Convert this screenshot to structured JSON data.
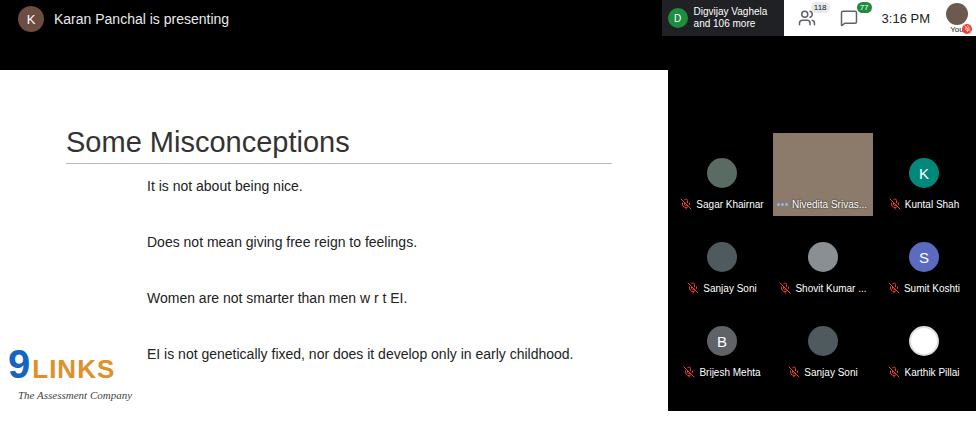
{
  "topbar": {
    "presenter": {
      "initial": "K",
      "text": "Karan Panchal is presenting",
      "color": "#6d4c41"
    },
    "participants_preview": {
      "initial": "D",
      "name": "Digvijay Vaghela",
      "more": "and 106 more",
      "color": "#1e8e3e"
    },
    "people_count": "118",
    "chat_count": "77",
    "time": "3:16 PM",
    "self": {
      "label": "You",
      "muted": true
    }
  },
  "slide": {
    "title": "Some Misconceptions",
    "bullets": [
      "It is not about being nice.",
      "Does not mean giving free reign to feelings.",
      "Women are not smarter than men w r t EI.",
      "EI is not genetically fixed, nor does it develop only in early childhood."
    ],
    "logo": {
      "number": "9",
      "word": "LINKS",
      "tagline": "The Assessment Company"
    }
  },
  "tiles": [
    {
      "name": "Sagar Khairnar",
      "kind": "photo",
      "initial": "",
      "color": "#5a6b63",
      "muted": true,
      "speaking": false
    },
    {
      "name": "Nivedita Srivas...",
      "kind": "video",
      "initial": "",
      "color": "#8c7b6b",
      "muted": false,
      "speaking": true
    },
    {
      "name": "Kuntal Shah",
      "kind": "initial",
      "initial": "K",
      "color": "#00897b",
      "muted": true,
      "speaking": false
    },
    {
      "name": "Sanjay Soni",
      "kind": "photo",
      "initial": "",
      "color": "#4e5a5e",
      "muted": true,
      "speaking": false
    },
    {
      "name": "Shovit Kumar ...",
      "kind": "photo",
      "initial": "",
      "color": "#8a8f94",
      "muted": true,
      "speaking": false
    },
    {
      "name": "Sumit Koshti",
      "kind": "initial",
      "initial": "S",
      "color": "#5c6bc0",
      "muted": true,
      "speaking": false
    },
    {
      "name": "Brijesh Mehta",
      "kind": "initial",
      "initial": "B",
      "color": "#5f6368",
      "muted": true,
      "speaking": false
    },
    {
      "name": "Sanjay Soni",
      "kind": "photo",
      "initial": "",
      "color": "#4e5a5e",
      "muted": true,
      "speaking": false
    },
    {
      "name": "Karthik Pillai",
      "kind": "logo",
      "initial": "",
      "color": "#ffffff",
      "muted": true,
      "speaking": false
    }
  ]
}
